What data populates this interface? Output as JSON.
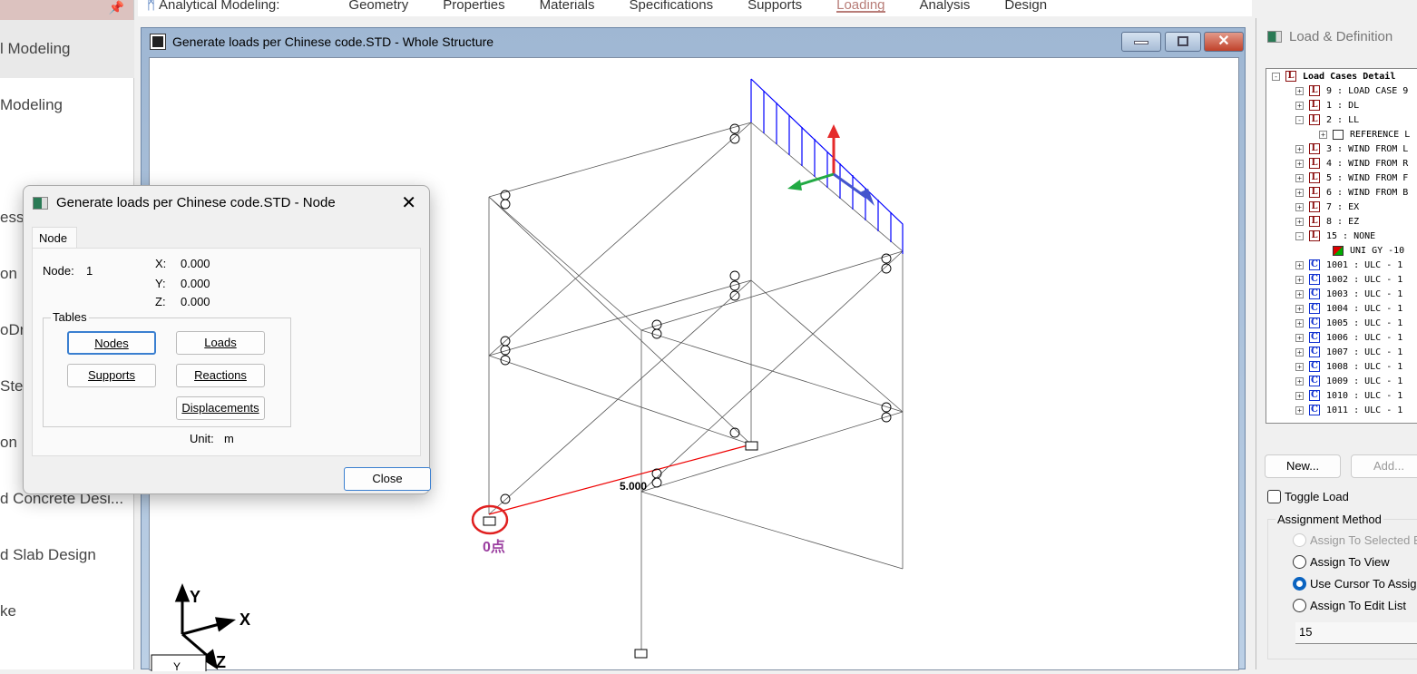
{
  "sidebar": {
    "items": [
      "l Modeling",
      "Modeling",
      "essin",
      "on D",
      "oDr",
      "Stee",
      "on D",
      "d Concrete Desi...",
      "d Slab Design",
      "ke"
    ]
  },
  "topbar": {
    "label": "Analytical Modeling:",
    "tabs": [
      "Geometry",
      "Properties",
      "Materials",
      "Specifications",
      "Supports",
      "Loading",
      "Analysis",
      "Design"
    ],
    "selected": "Loading"
  },
  "main_window": {
    "title": "Generate loads per Chinese code.STD - Whole Structure"
  },
  "viewport": {
    "dimension_label": "5.000",
    "origin_label": "0点",
    "axes": {
      "x": "X",
      "y": "Y",
      "z": "Z"
    },
    "corner_label": "Y"
  },
  "node_dialog": {
    "title": "Generate loads per Chinese code.STD - Node",
    "tab": "Node",
    "node_label": "Node:",
    "node_value": "1",
    "x_label": "X:",
    "x": "0.000",
    "y_label": "Y:",
    "y": "0.000",
    "z_label": "Z:",
    "z": "0.000",
    "tables_label": "Tables",
    "buttons": {
      "nodes": "Nodes",
      "loads": "Loads",
      "supports": "Supports",
      "reactions": "Reactions",
      "displacements": "Displacements"
    },
    "unit_label": "Unit:",
    "unit": "m",
    "close": "Close"
  },
  "right_panel": {
    "title": "Load & Definition",
    "tree": [
      {
        "pm": "-",
        "icon": "L",
        "text": "Load Cases Detail",
        "level": 0,
        "bold": true
      },
      {
        "pm": "+",
        "icon": "L",
        "text": "9 : LOAD CASE 9",
        "level": 1
      },
      {
        "pm": "+",
        "icon": "L",
        "text": "1 : DL",
        "level": 1
      },
      {
        "pm": "-",
        "icon": "L",
        "text": "2 : LL",
        "level": 1
      },
      {
        "pm": "+",
        "icon": "R",
        "text": "REFERENCE L",
        "level": 2
      },
      {
        "pm": "+",
        "icon": "L",
        "text": "3 : WIND FROM L",
        "level": 1
      },
      {
        "pm": "+",
        "icon": "L",
        "text": "4 : WIND FROM R",
        "level": 1
      },
      {
        "pm": "+",
        "icon": "L",
        "text": "5 : WIND FROM F",
        "level": 1
      },
      {
        "pm": "+",
        "icon": "L",
        "text": "6 : WIND FROM B",
        "level": 1
      },
      {
        "pm": "+",
        "icon": "L",
        "text": "7 : EX",
        "level": 1
      },
      {
        "pm": "+",
        "icon": "L",
        "text": "8 : EZ",
        "level": 1
      },
      {
        "pm": "-",
        "icon": "L",
        "text": "15 : NONE",
        "level": 1
      },
      {
        "pm": "",
        "icon": "U",
        "text": "UNI GY -10",
        "level": 2
      },
      {
        "pm": "+",
        "icon": "C",
        "text": "1001 : ULC - 1",
        "level": 1
      },
      {
        "pm": "+",
        "icon": "C",
        "text": "1002 : ULC - 1",
        "level": 1
      },
      {
        "pm": "+",
        "icon": "C",
        "text": "1003 : ULC - 1",
        "level": 1
      },
      {
        "pm": "+",
        "icon": "C",
        "text": "1004 : ULC - 1",
        "level": 1
      },
      {
        "pm": "+",
        "icon": "C",
        "text": "1005 : ULC - 1",
        "level": 1
      },
      {
        "pm": "+",
        "icon": "C",
        "text": "1006 : ULC - 1",
        "level": 1
      },
      {
        "pm": "+",
        "icon": "C",
        "text": "1007 : ULC - 1",
        "level": 1
      },
      {
        "pm": "+",
        "icon": "C",
        "text": "1008 : ULC - 1",
        "level": 1
      },
      {
        "pm": "+",
        "icon": "C",
        "text": "1009 : ULC - 1",
        "level": 1
      },
      {
        "pm": "+",
        "icon": "C",
        "text": "1010 : ULC - 1",
        "level": 1
      },
      {
        "pm": "+",
        "icon": "C",
        "text": "1011 : ULC - 1",
        "level": 1
      }
    ],
    "new_button": "New...",
    "add_button": "Add...",
    "toggle_load": "Toggle Load",
    "assignment_method": "Assignment Method",
    "radios": [
      "Assign To Selected B",
      "Assign To View",
      "Use Cursor To Assign",
      "Assign To Edit List"
    ],
    "selected_radio": 2,
    "edit_value": "15"
  }
}
